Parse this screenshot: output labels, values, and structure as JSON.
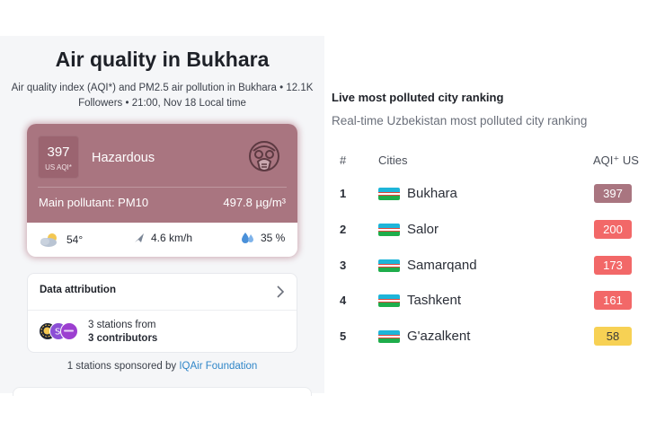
{
  "left": {
    "title": "Air quality in Bukhara",
    "subtitle_line1": "Air quality index (AQI*) and PM2.5 air pollution in Bukhara • 12.1K",
    "subtitle_line2": "Followers • 21:00, Nov 18 Local time",
    "aqi": {
      "value": "397",
      "unit": "US AQI*",
      "status": "Hazardous",
      "pollutant_label": "Main pollutant: PM10",
      "pollutant_value": "497.8 µg/m³",
      "color": "#a97580"
    },
    "weather": {
      "temperature": "54°",
      "wind": "4.6 km/h",
      "humidity": "35 %"
    },
    "attribution": {
      "title": "Data attribution",
      "stations_line1": "3 stations from",
      "stations_line2": "3 contributors"
    },
    "sponsor_text": "1 stations sponsored by",
    "sponsor_link": "IQAir Foundation"
  },
  "right": {
    "title": "Live most polluted city ranking",
    "subtitle": "Real-time Uzbekistan most polluted city ranking",
    "headers": {
      "rank": "#",
      "city": "Cities",
      "aqi": "AQI⁺ US"
    },
    "rows": [
      {
        "rank": "1",
        "city": "Bukhara",
        "aqi": "397",
        "color": "#a97580",
        "text_color": "#ffffff"
      },
      {
        "rank": "2",
        "city": "Salor",
        "aqi": "200",
        "color": "#f26868",
        "text_color": "#ffffff"
      },
      {
        "rank": "3",
        "city": "Samarqand",
        "aqi": "173",
        "color": "#f26868",
        "text_color": "#ffffff"
      },
      {
        "rank": "4",
        "city": "Tashkent",
        "aqi": "161",
        "color": "#f26868",
        "text_color": "#ffffff"
      },
      {
        "rank": "5",
        "city": "G'azalkent",
        "aqi": "58",
        "color": "#f7d154",
        "text_color": "#3a3a3a"
      }
    ]
  }
}
